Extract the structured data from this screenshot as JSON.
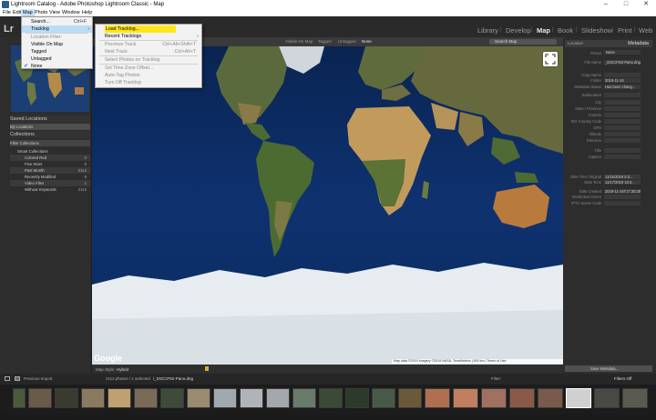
{
  "window": {
    "title": "Lightroom Catalog - Adobe Photoshop Lightroom Classic - Map",
    "minimize": "–",
    "maximize": "□",
    "close": "✕"
  },
  "menubar": [
    "File",
    "Edit",
    "Map",
    "Photo",
    "View",
    "Window",
    "Help"
  ],
  "logo": "Lr",
  "modules": [
    "Library",
    "Develop",
    "Map",
    "Book",
    "Slideshow",
    "Print",
    "Web"
  ],
  "active_module": "Map",
  "map_menu": {
    "items": [
      {
        "label": "Search...",
        "shortcut": "Ctrl+F",
        "state": "normal"
      },
      {
        "label": "Tracklog",
        "shortcut": "",
        "state": "highlight",
        "submenu": true
      },
      {
        "label": "Location Filter:",
        "shortcut": "",
        "state": "disabled"
      },
      {
        "label": "Visible On Map",
        "shortcut": "",
        "state": "normal"
      },
      {
        "label": "Tagged",
        "shortcut": "",
        "state": "normal"
      },
      {
        "label": "Untagged",
        "shortcut": "",
        "state": "normal"
      },
      {
        "label": "None",
        "shortcut": "",
        "state": "checked"
      }
    ]
  },
  "tracklog_menu": {
    "items": [
      {
        "label": "Load Tracklog...",
        "shortcut": "",
        "state": "yellow"
      },
      {
        "label": "Recent Tracklogs",
        "shortcut": "",
        "state": "normal",
        "submenu": true
      },
      {
        "label": "Previous Track",
        "shortcut": "Ctrl+Alt+Shift+T",
        "state": "disabled"
      },
      {
        "label": "Next Track",
        "shortcut": "Ctrl+Alt+T",
        "state": "disabled"
      },
      {
        "label": "Select Photos on Tracklog",
        "shortcut": "",
        "state": "disabled"
      },
      {
        "label": "Set Time Zone Offset...",
        "shortcut": "",
        "state": "disabled"
      },
      {
        "label": "Auto-Tag Photos",
        "shortcut": "",
        "state": "disabled"
      },
      {
        "label": "Turn Off Tracklog",
        "shortcut": "",
        "state": "disabled"
      }
    ]
  },
  "left_panel": {
    "saved_locations": "Saved Locations",
    "collections": "Collections",
    "filter_collections": "Filter Collections",
    "smart_collections": "Smart Collections",
    "my_locations": "My Locations",
    "rows": [
      {
        "label": "Colored Red",
        "count": "0"
      },
      {
        "label": "Five Stars",
        "count": "0"
      },
      {
        "label": "Past Month",
        "count": "2112"
      },
      {
        "label": "Recently Modified",
        "count": "8"
      },
      {
        "label": "Video Files",
        "count": "1"
      },
      {
        "label": "Without Keywords",
        "count": "2112"
      }
    ]
  },
  "map_toolbar": {
    "labels": [
      "Visible On Map",
      "Tagged",
      "Untagged",
      "None"
    ],
    "search": "Search Map"
  },
  "map": {
    "google": "Google",
    "attribution": "Map data ©2019 Imagery ©2019 NASA, TerraMetrics  |  500 km  |  Terms of Use",
    "map_style_label": "Map Style:",
    "map_style": "Hybrid"
  },
  "right_panel": {
    "title": "Metadata",
    "location_label": "Location",
    "preset_label": "Preset",
    "preset_value": "None",
    "fields": [
      {
        "label": "File Name",
        "value": "_DSC3762-Pano.dng"
      },
      {
        "label": "Copy Name",
        "value": ""
      },
      {
        "label": "Folder",
        "value": "2019-11-16"
      },
      {
        "label": "Metadata Status",
        "value": "Has been chang..."
      },
      {
        "label": "Sublocation",
        "value": ""
      },
      {
        "label": "City",
        "value": ""
      },
      {
        "label": "State / Province",
        "value": ""
      },
      {
        "label": "Country",
        "value": ""
      },
      {
        "label": "ISO Country Code",
        "value": ""
      },
      {
        "label": "GPS",
        "value": ""
      },
      {
        "label": "Altitude",
        "value": ""
      },
      {
        "label": "Direction",
        "value": ""
      },
      {
        "label": "Title",
        "value": ""
      },
      {
        "label": "Caption",
        "value": ""
      },
      {
        "label": "Date Time Original",
        "value": "11/16/2019 5:3..."
      },
      {
        "label": "Date Time",
        "value": "11/17/2019 10:3..."
      },
      {
        "label": "Date Created",
        "value": "2019-11-16T17:30:29"
      },
      {
        "label": "Intellectual Genre",
        "value": ""
      },
      {
        "label": "IPTC Scene Code",
        "value": ""
      }
    ],
    "save_metadata": "Save Metadata..."
  },
  "filmbar": {
    "source": "Previous Import",
    "count": "2112 photos / 1 selected",
    "filename": "/_DSC3762-Pano.dng",
    "filter_label": "Filter:",
    "filters_off": "Filters Off"
  },
  "colors": {
    "ocean": "#0c2c63",
    "ice": "#e6ecf0",
    "highlight": "#bcdcf4",
    "yellow": "#ffe61a"
  }
}
